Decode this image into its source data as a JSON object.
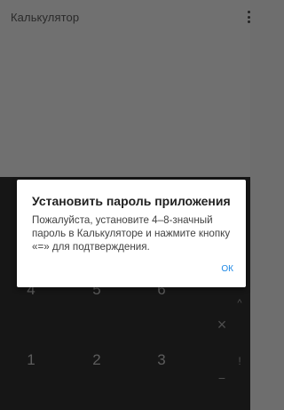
{
  "app": {
    "title": "Калькулятор"
  },
  "dialog": {
    "title": "Установить пароль приложения",
    "message": "Пожалуйста, установите 4–8-значный пароль в Калькуляторе и нажмите кнопку «=» для подтверждения.",
    "ok_label": "ОК"
  },
  "keypad": {
    "row_top": [
      "4",
      "5",
      "6"
    ],
    "row_bottom": [
      "1",
      "2",
      "3"
    ],
    "side": {
      "caret": "^",
      "close": "×",
      "exclaim": "!",
      "minus": "−"
    }
  },
  "colors": {
    "accent": "#1e88e5",
    "display_bg": "#707070",
    "keypad_bg": "#161616"
  }
}
